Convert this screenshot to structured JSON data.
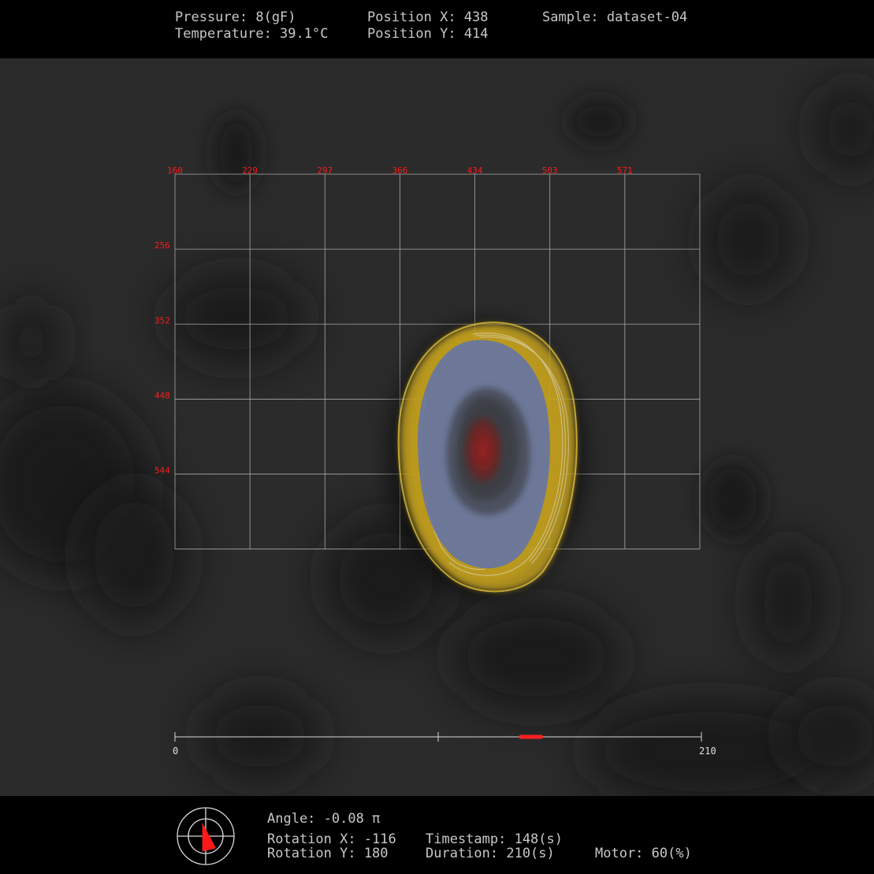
{
  "top_readout": {
    "pressure": "Pressure: 8(gF)",
    "temperature": "Temperature: 39.1°C",
    "position_x": "Position X: 438",
    "position_y": "Position Y: 414",
    "sample": "Sample: dataset-04"
  },
  "grid": {
    "x_ticks": [
      "160",
      "229",
      "297",
      "366",
      "434",
      "503",
      "571"
    ],
    "y_ticks": [
      "256",
      "352",
      "448",
      "544"
    ],
    "tick_color": "#ff1a1a"
  },
  "timeline": {
    "start_label": "0",
    "end_label": "210",
    "min": 0,
    "max": 210,
    "mid": 105,
    "marker_start": 138,
    "marker_end": 146
  },
  "bottom_readout": {
    "angle": "Angle: -0.08 π",
    "rotation_x": "Rotation X: -116",
    "rotation_y": "Rotation Y: 180",
    "timestamp": "Timestamp: 148(s)",
    "duration": "Duration: 210(s)",
    "motor": "Motor: 60(%)"
  },
  "colors": {
    "accent": "#ff2020",
    "shape_outer": "#e6c22a",
    "shape_blue": "#6a7aa8",
    "shape_core": "#8a2a2a"
  },
  "icons": {
    "compass": "compass-icon"
  }
}
